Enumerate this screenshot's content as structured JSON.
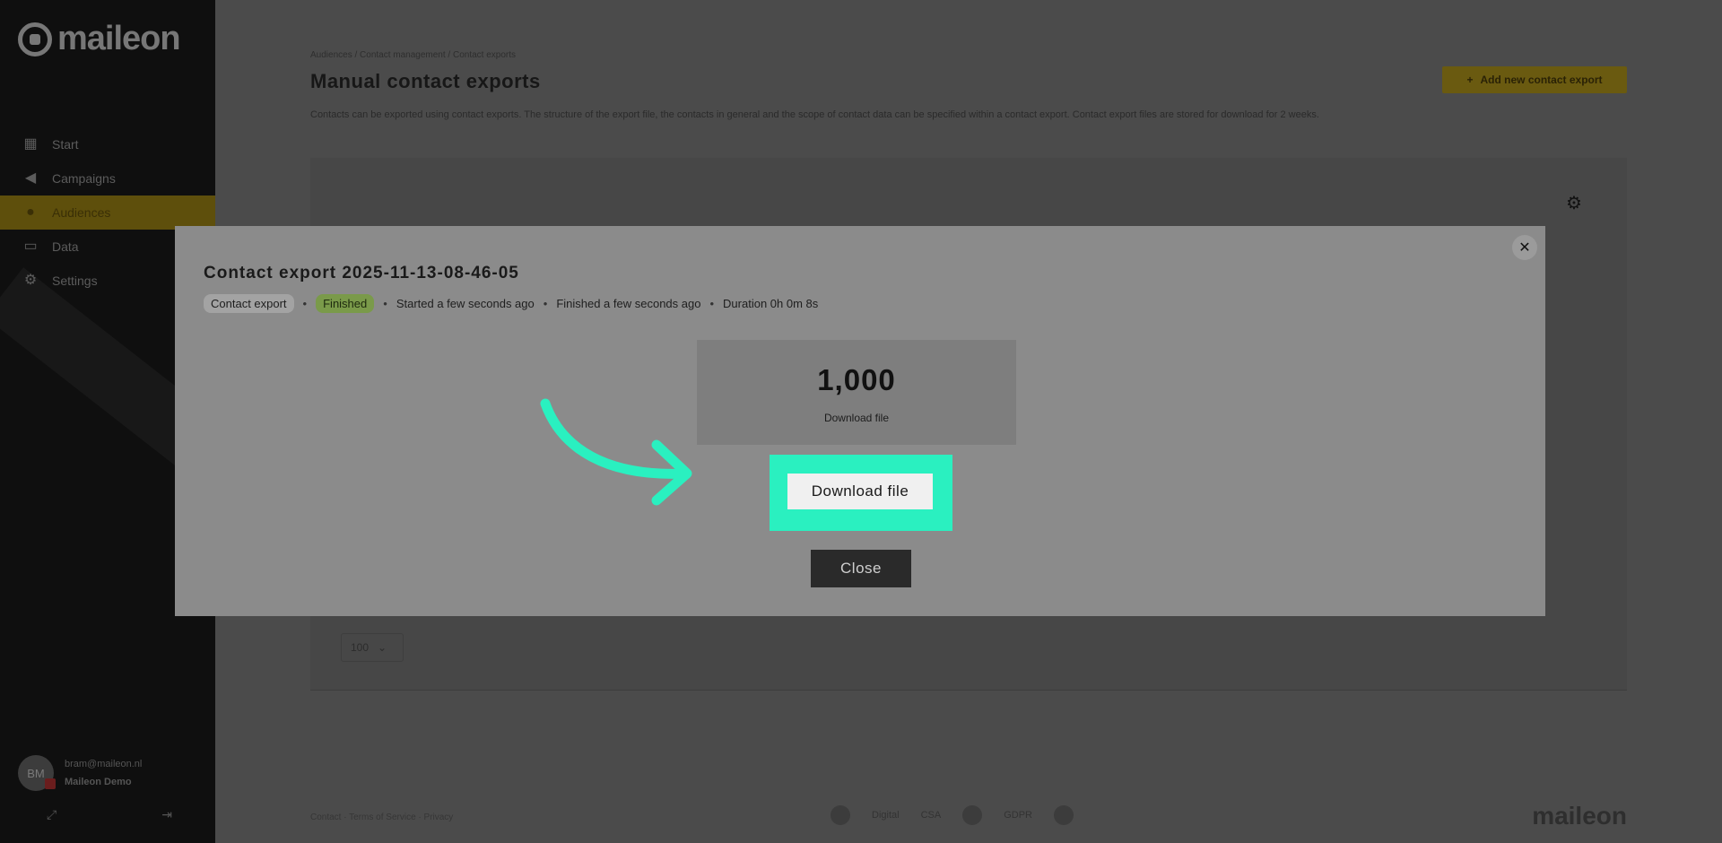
{
  "sidebar": {
    "brand": "maileon",
    "items": [
      {
        "label": "Start",
        "icon": "dashboard-icon"
      },
      {
        "label": "Campaigns",
        "icon": "megaphone-icon"
      },
      {
        "label": "Audiences",
        "icon": "people-icon",
        "active": true
      },
      {
        "label": "Data",
        "icon": "folder-icon"
      },
      {
        "label": "Settings",
        "icon": "gear-icon"
      }
    ],
    "user": {
      "initials": "BM",
      "email": "bram@maileon.nl",
      "account": "Maileon Demo"
    }
  },
  "header": {
    "breadcrumb": "Audiences  /  Contact management  /  Contact exports",
    "title": "Manual contact exports",
    "description": "Contacts can be exported using contact exports. The structure of the export file, the contacts in general and the scope of contact data can be specified within a contact export. Contact export files are stored for download for 2 weeks.",
    "add_button": "Add new contact export"
  },
  "table": {
    "page_size": "100"
  },
  "footer": {
    "links": "Contact · Terms of Service · Privacy",
    "mid_text_1": "Digital",
    "mid_text_2": "CSA",
    "mid_text_3": "GDPR",
    "brand": "maileon"
  },
  "modal": {
    "title": "Contact export 2025-11-13-08-46-05",
    "type_chip": "Contact export",
    "status_chip": "Finished",
    "started": "Started a few seconds ago",
    "finished": "Finished a few seconds ago",
    "duration": "Duration 0h 0m 8s",
    "count": "1,000",
    "count_label": "Download file",
    "download_button": "Download file",
    "close_button": "Close"
  },
  "colors": {
    "highlight": "#2af0c0",
    "accent": "#f5c518"
  }
}
